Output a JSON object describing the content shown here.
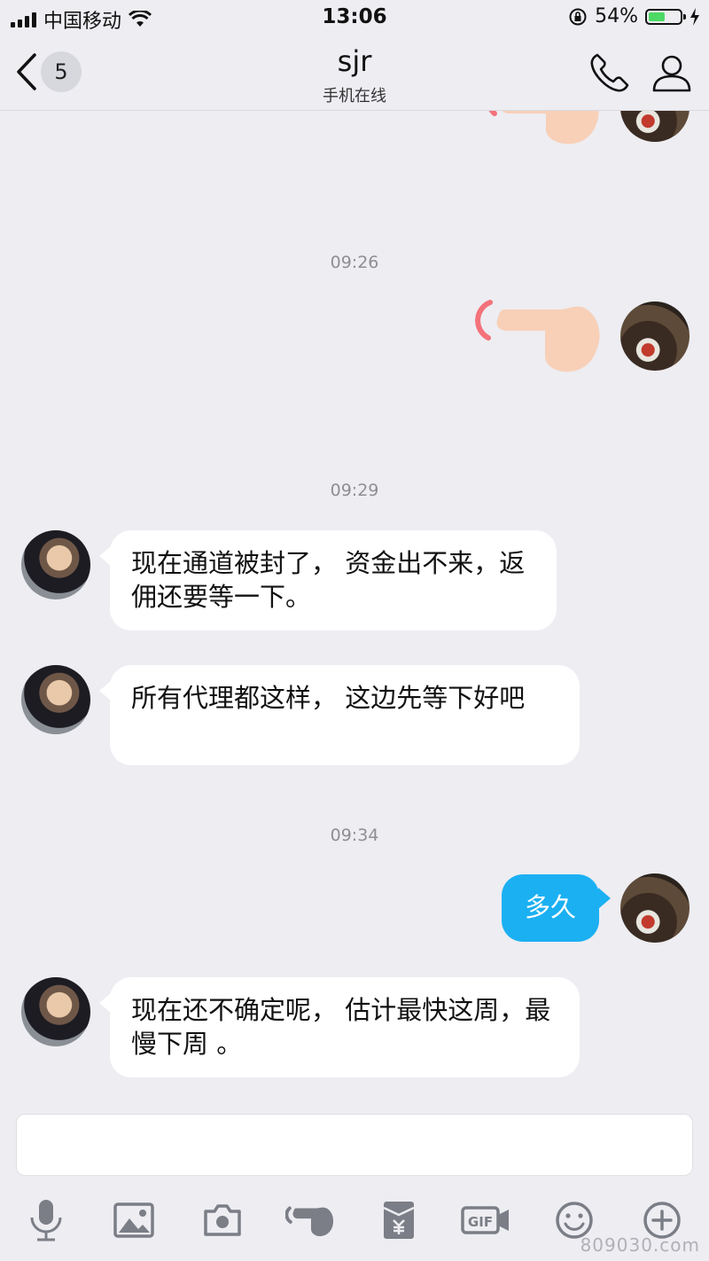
{
  "status_bar": {
    "carrier": "中国移动",
    "time": "13:06",
    "battery": "54%",
    "battery_level": 0.54
  },
  "header": {
    "back_label": "back",
    "unread_count": "5",
    "title": "sjr",
    "subtitle": "手机在线",
    "call_icon": "phone-icon",
    "profile_icon": "person-icon"
  },
  "timestamps": [
    "09:26",
    "09:29",
    "09:34"
  ],
  "messages": [
    {
      "sender": "self",
      "type": "poke",
      "icon": "poke-hand-icon"
    },
    {
      "sender": "other",
      "type": "text",
      "text": "现在通道被封了， 资金出不来，返佣还要等一下。"
    },
    {
      "sender": "other",
      "type": "text",
      "text": "所有代理都这样， 这边先等下好吧"
    },
    {
      "sender": "self",
      "type": "text",
      "text": "多久"
    },
    {
      "sender": "other",
      "type": "text",
      "text": "现在还不确定呢， 估计最快这周，最慢下周 。"
    }
  ],
  "toolbar": {
    "icons": [
      "microphone-icon",
      "image-icon",
      "camera-icon",
      "poke-icon",
      "red-packet-icon",
      "gif-icon",
      "emoji-icon",
      "plus-icon"
    ]
  },
  "watermark": "809030.com",
  "colors": {
    "background": "#ededf2",
    "self_bubble": "#1bb0f2",
    "other_bubble": "#ffffff",
    "battery_fill": "#4cd964"
  }
}
